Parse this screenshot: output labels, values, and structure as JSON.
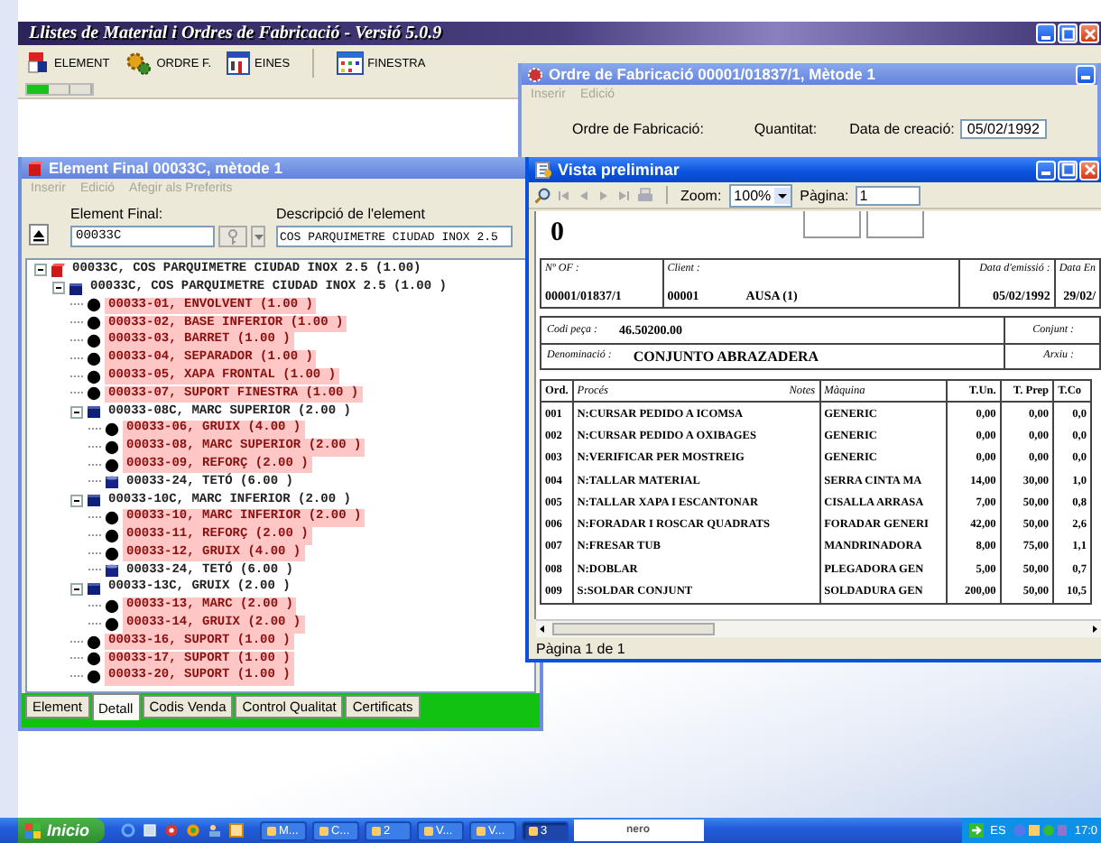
{
  "main_window": {
    "title": "Llistes de Material i Ordres de Fabricació - Versió 5.0.9",
    "toolbar": [
      {
        "label": "ELEMENT",
        "kind": "element"
      },
      {
        "label": "ORDRE F.",
        "kind": "order"
      },
      {
        "label": "EINES",
        "kind": "tools"
      },
      {
        "label": "FINESTRA",
        "kind": "window"
      }
    ],
    "progress": {
      "level": 0.33
    }
  },
  "order_window": {
    "title": "Ordre de Fabricació 00001/01837/1, Mètode 1",
    "active": false,
    "menu": [
      {
        "label": "Inserir",
        "disabled": true
      },
      {
        "label": "Edició",
        "disabled": true
      }
    ],
    "order_label": "Ordre de Fabricació:",
    "quantity_label": "Quantitat:",
    "date_label": "Data de creació:",
    "date_value": "05/02/1992"
  },
  "element_window": {
    "title": "Element Final 00033C, mètode 1",
    "active": false,
    "menu": [
      {
        "label": "Inserir",
        "disabled": true
      },
      {
        "label": "Edició",
        "disabled": true
      },
      {
        "label": "Afegir als Preferits",
        "disabled": true
      }
    ],
    "element_label": "Element Final:",
    "element_value": "00033C",
    "description_label": "Descripció de l'element",
    "description_value": "COS PARQUIMETRE CIUDAD INOX 2.5",
    "tree": [
      {
        "label": "00033C, COS PARQUIMETRE CIUDAD INOX 2.5 (1.00)",
        "kind": "assembly",
        "highlighted": false,
        "expanded": true,
        "children": [
          {
            "label": "00033C, COS PARQUIMETRE CIUDAD INOX 2.5 (1.00 )",
            "kind": "subassembly",
            "highlighted": false,
            "expanded": true,
            "children": [
              {
                "label": "00033-01, ENVOLVENT (1.00 )",
                "kind": "part",
                "highlighted": true
              },
              {
                "label": "00033-02, BASE INFERIOR (1.00 )",
                "kind": "part",
                "highlighted": true
              },
              {
                "label": "00033-03, BARRET (1.00 )",
                "kind": "part",
                "highlighted": true
              },
              {
                "label": "00033-04, SEPARADOR (1.00 )",
                "kind": "part",
                "highlighted": true
              },
              {
                "label": "00033-05, XAPA FRONTAL (1.00 )",
                "kind": "part",
                "highlighted": true
              },
              {
                "label": "00033-07, SUPORT FINESTRA (1.00 )",
                "kind": "part",
                "highlighted": true
              },
              {
                "label": "00033-08C, MARC SUPERIOR (2.00 )",
                "kind": "subassembly",
                "highlighted": false,
                "expanded": true,
                "children": [
                  {
                    "label": "00033-06, GRUIX (4.00 )",
                    "kind": "part",
                    "highlighted": true
                  },
                  {
                    "label": "00033-08, MARC SUPERIOR (2.00 )",
                    "kind": "part",
                    "highlighted": true
                  },
                  {
                    "label": "00033-09, REFORÇ (2.00 )",
                    "kind": "part",
                    "highlighted": true
                  },
                  {
                    "label": "00033-24, TETÓ (6.00 )",
                    "kind": "material",
                    "highlighted": false
                  }
                ]
              },
              {
                "label": "00033-10C, MARC INFERIOR (2.00 )",
                "kind": "subassembly",
                "highlighted": false,
                "expanded": true,
                "children": [
                  {
                    "label": "00033-10, MARC INFERIOR (2.00 )",
                    "kind": "part",
                    "highlighted": true
                  },
                  {
                    "label": "00033-11, REFORÇ (2.00 )",
                    "kind": "part",
                    "highlighted": true
                  },
                  {
                    "label": "00033-12, GRUIX (4.00 )",
                    "kind": "part",
                    "highlighted": true
                  },
                  {
                    "label": "00033-24, TETÓ (6.00 )",
                    "kind": "material",
                    "highlighted": false
                  }
                ]
              },
              {
                "label": "00033-13C, GRUIX (2.00 )",
                "kind": "subassembly",
                "highlighted": false,
                "expanded": true,
                "children": [
                  {
                    "label": "00033-13, MARC (2.00 )",
                    "kind": "part",
                    "highlighted": true
                  },
                  {
                    "label": "00033-14, GRUIX (2.00 )",
                    "kind": "part",
                    "highlighted": true
                  }
                ]
              },
              {
                "label": "00033-16, SUPORT (1.00 )",
                "kind": "part",
                "highlighted": true
              },
              {
                "label": "00033-17, SUPORT (1.00 )",
                "kind": "part",
                "highlighted": true
              },
              {
                "label": "00033-20, SUPORT (1.00 )",
                "kind": "part",
                "highlighted": true
              }
            ]
          }
        ]
      }
    ],
    "tabs": [
      {
        "label": "Element",
        "selected": false
      },
      {
        "label": "Detall",
        "selected": true
      },
      {
        "label": "Codis Venda",
        "selected": false
      },
      {
        "label": "Control Qualitat",
        "selected": false
      },
      {
        "label": "Certificats",
        "selected": false
      }
    ]
  },
  "preview_window": {
    "title": "Vista preliminar",
    "active": true,
    "zoom_label": "Zoom:",
    "zoom_value": "100%",
    "page_label": "Pàgina:",
    "page_value": "1",
    "document": {
      "number": "0",
      "order_label": "Nº OF :",
      "order_value": "00001/01837/1",
      "client_label": "Client :",
      "client_code": "00001",
      "client_name": "AUSA (1)",
      "issue_label": "Data d'emissió :",
      "issue_value": "05/02/1992",
      "delivery_label": "Data En",
      "delivery_value": "29/02/",
      "part_label": "Codi peça :",
      "part_value": "46.50200.00",
      "set_label": "Conjunt :",
      "name_label": "Denominació :",
      "name_value": "CONJUNTO ABRAZADERA",
      "file_label": "Arxiu :",
      "columns": [
        "Ord.",
        "Procés",
        "Màquina",
        "T.Un.",
        "T. Prep",
        "T.Co"
      ],
      "notes_label": "Notes",
      "rows": [
        [
          "001",
          "N:CURSAR PEDIDO A ICOMSA",
          "GENERIC",
          "0,00",
          "0,00",
          "0,0"
        ],
        [
          "002",
          "N:CURSAR PEDIDO A OXIBAGES",
          "GENERIC",
          "0,00",
          "0,00",
          "0,0"
        ],
        [
          "003",
          "N:VERIFICAR PER MOSTREIG",
          "GENERIC",
          "0,00",
          "0,00",
          "0,0"
        ],
        [
          "004",
          "N:TALLAR MATERIAL",
          "SERRA CINTA MA",
          "14,00",
          "30,00",
          "1,0"
        ],
        [
          "005",
          "N:TALLAR XAPA I ESCANTONAR",
          "CISALLA ARRASA",
          "7,00",
          "50,00",
          "0,8"
        ],
        [
          "006",
          "N:FORADAR I ROSCAR QUADRATS",
          "FORADAR GENERI",
          "42,00",
          "50,00",
          "2,6"
        ],
        [
          "007",
          "N:FRESAR TUB",
          "MANDRINADORA",
          "8,00",
          "75,00",
          "1,1"
        ],
        [
          "008",
          "N:DOBLAR",
          "PLEGADORA GEN",
          "5,00",
          "50,00",
          "0,7"
        ],
        [
          "009",
          "S:SOLDAR CONJUNT",
          "SOLDADURA GEN",
          "200,00",
          "50,00",
          "10,5"
        ]
      ]
    },
    "status": "Pàgina 1 de 1"
  },
  "taskbar": {
    "start": "Inicio",
    "tasks": [
      {
        "label": "M...",
        "selected": false
      },
      {
        "label": "C...",
        "selected": false
      },
      {
        "label": "2",
        "selected": false
      },
      {
        "label": "V...",
        "selected": false
      },
      {
        "label": "V...",
        "selected": false
      },
      {
        "label": "3",
        "selected": true
      }
    ],
    "nero": "nero",
    "language": "ES",
    "clock": "17:0"
  }
}
